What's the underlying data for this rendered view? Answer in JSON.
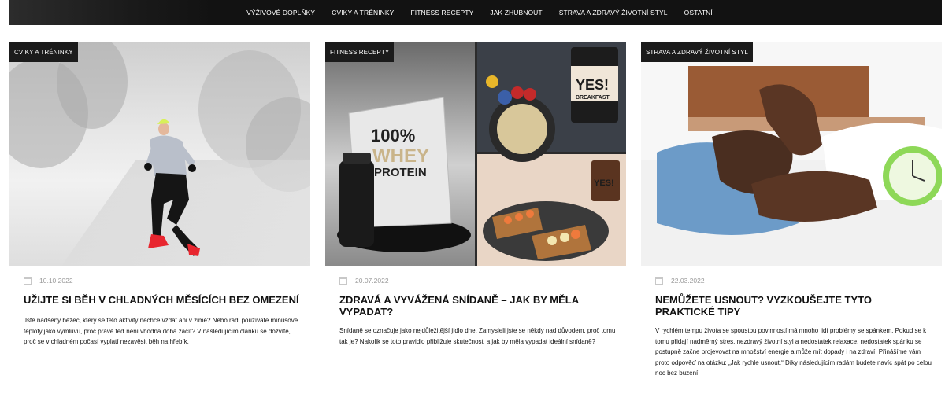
{
  "nav": {
    "items": [
      "VÝŽIVOVÉ DOPLŇKY",
      "CVIKY A TRÉNINKY",
      "FITNESS RECEPTY",
      "JAK ZHUBNOUT",
      "STRAVA A ZDRAVÝ ŽIVOTNÍ STYL",
      "OSTATNÍ"
    ],
    "separator": "·"
  },
  "articles": [
    {
      "category": "CVIKY A TRÉNINKY",
      "date": "10.10.2022",
      "title": "UŽIJTE SI BĚH V CHLADNÝCH MĚSÍCÍCH BEZ OMEZENÍ",
      "excerpt": "Jste nadšený běžec, který se této aktivity nechce vzdát ani v zimě? Nebo rádi používáte mínusové teploty jako výmluvu, proč právě teď není vhodná doba začít? V následujícím článku se dozvíte, proč se v chladném počasí vyplatí nezavěsit běh na hřebík."
    },
    {
      "category": "FITNESS RECEPTY",
      "date": "20.07.2022",
      "title": "ZDRAVÁ A VYVÁŽENÁ SNÍDANĚ – JAK BY MĚLA VYPADAT?",
      "excerpt": "Snídaně se označuje jako nejdůležitější jídlo dne. Zamysleli jste se někdy nad důvodem, proč tomu tak je? Nakolik se toto pravidlo přibližuje skutečnosti a jak by měla vypadat ideální snídaně?",
      "image_text": {
        "bag_line1": "100%",
        "bag_line2": "WHEY",
        "bag_line3": "PROTEIN",
        "jar_text": "YES!",
        "jar_sub": "BREAKFAST",
        "jar2_text": "YES!"
      }
    },
    {
      "category": "STRAVA A ZDRAVÝ ŽIVOTNÍ STYL",
      "date": "22.03.2022",
      "title": "NEMŮŽETE USNOUT? VYZKOUŠEJTE TYTO PRAKTICKÉ TIPY",
      "excerpt": "V rychlém tempu života se spoustou povinností má mnoho lidí problémy se spánkem. Pokud se k tomu přidají nadměrný stres, nezdravý životní styl a nedostatek relaxace, nedostatek spánku se postupně začne projevovat na množství energie a může mít dopady i na zdraví. Přinášíme vám proto odpověď na otázku: „Jak rychle usnout.“ Díky následujícím radám budete navíc spát po celou noc bez buzení."
    }
  ],
  "icons": {
    "date": "calendar-icon"
  },
  "colors": {
    "nav_bg": "#121212",
    "badge_bg": "#1b1b1b",
    "date_text": "#9a9a9a"
  }
}
